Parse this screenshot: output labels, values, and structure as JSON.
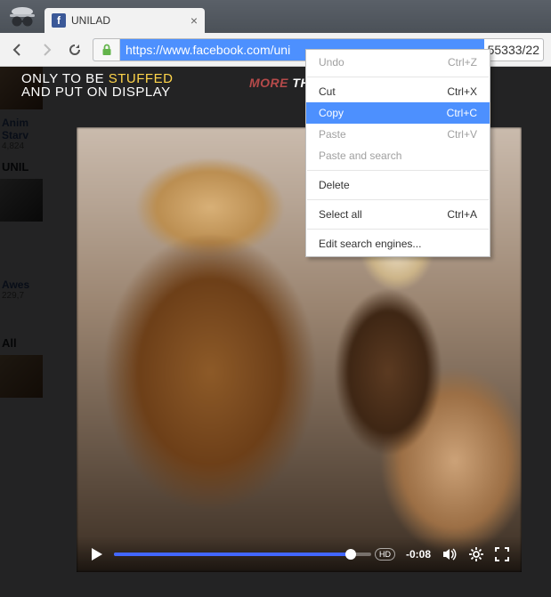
{
  "browser": {
    "tab_title": "UNILAD",
    "url_selected": "https://www.facebook.com/uni",
    "url_tail": "55333/22"
  },
  "context_menu": {
    "undo": {
      "label": "Undo",
      "shortcut": "Ctrl+Z"
    },
    "cut": {
      "label": "Cut",
      "shortcut": "Ctrl+X"
    },
    "copy": {
      "label": "Copy",
      "shortcut": "Ctrl+C"
    },
    "paste": {
      "label": "Paste",
      "shortcut": "Ctrl+V"
    },
    "paste_search": {
      "label": "Paste and search",
      "shortcut": ""
    },
    "delete": {
      "label": "Delete",
      "shortcut": ""
    },
    "select_all": {
      "label": "Select all",
      "shortcut": "Ctrl+A"
    },
    "edit_engines": {
      "label": "Edit search engines...",
      "shortcut": ""
    }
  },
  "video": {
    "time_remaining": "-0:08",
    "progress_pct": 92,
    "hd": "HD"
  },
  "sidebar": {
    "item1": {
      "title": "Anim",
      "title2": "Starv",
      "meta": "4,824"
    },
    "heading1": "UNIL",
    "item2": {
      "title": "Awes",
      "meta": "229,7"
    },
    "heading2": "All"
  },
  "overlay": {
    "line1_a": "ONLY TO BE ",
    "line1_b": "STUFFED",
    "line2": "AND PUT ON DISPLAY",
    "more_word": "MORE",
    "than_word": "THAN"
  }
}
